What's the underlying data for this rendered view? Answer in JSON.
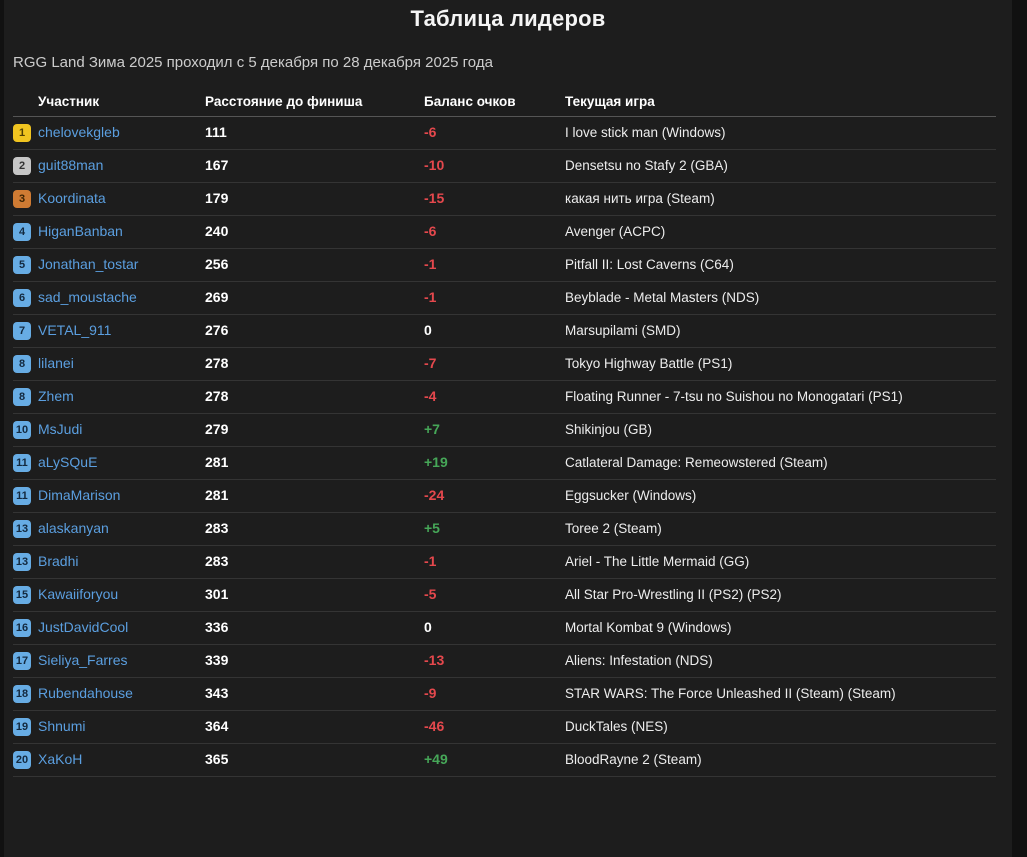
{
  "page": {
    "title": "Таблица лидеров",
    "subtitle": "RGG Land Зима 2025 проходил с 5 декабря по 28 декабря 2025 года"
  },
  "colors": {
    "accent_link": "#5b9fe0",
    "negative": "#e5484d",
    "positive": "#46a758",
    "badge_gold": "#f0c420",
    "badge_silver": "#c6c6c6",
    "badge_bronze": "#cf7b33",
    "badge_blue": "#67ace4"
  },
  "table": {
    "columns": [
      "Участник",
      "Расстояние до финиша",
      "Баланс очков",
      "Текущая игра"
    ],
    "rows": [
      {
        "rank": "1",
        "name": "chelovekgleb",
        "distance": "111",
        "balance": "-6",
        "game": "I love stick man (Windows)"
      },
      {
        "rank": "2",
        "name": "guit88man",
        "distance": "167",
        "balance": "-10",
        "game": "Densetsu no Stafy 2 (GBA)"
      },
      {
        "rank": "3",
        "name": "Koordinata",
        "distance": "179",
        "balance": "-15",
        "game": "какая нить игра (Steam)"
      },
      {
        "rank": "4",
        "name": "HiganBanban",
        "distance": "240",
        "balance": "-6",
        "game": "Avenger (ACPC)"
      },
      {
        "rank": "5",
        "name": "Jonathan_tostar",
        "distance": "256",
        "balance": "-1",
        "game": "Pitfall II: Lost Caverns (C64)"
      },
      {
        "rank": "6",
        "name": "sad_moustache",
        "distance": "269",
        "balance": "-1",
        "game": "Beyblade - Metal Masters (NDS)"
      },
      {
        "rank": "7",
        "name": "VETAL_911",
        "distance": "276",
        "balance": "0",
        "game": "Marsupilami (SMD)"
      },
      {
        "rank": "8",
        "name": "lilanei",
        "distance": "278",
        "balance": "-7",
        "game": "Tokyo Highway Battle (PS1)"
      },
      {
        "rank": "8",
        "name": "Zhem",
        "distance": "278",
        "balance": "-4",
        "game": "Floating Runner - 7-tsu no Suishou no Monogatari (PS1)"
      },
      {
        "rank": "10",
        "name": "MsJudi",
        "distance": "279",
        "balance": "+7",
        "game": "Shikinjou (GB)"
      },
      {
        "rank": "11",
        "name": "aLySQuE",
        "distance": "281",
        "balance": "+19",
        "game": "Catlateral Damage: Remeowstered (Steam)"
      },
      {
        "rank": "11",
        "name": "DimaMarison",
        "distance": "281",
        "balance": "-24",
        "game": "Eggsucker (Windows)"
      },
      {
        "rank": "13",
        "name": "alaskanyan",
        "distance": "283",
        "balance": "+5",
        "game": "Toree 2 (Steam)"
      },
      {
        "rank": "13",
        "name": "Bradhi",
        "distance": "283",
        "balance": "-1",
        "game": "Ariel - The Little Mermaid (GG)"
      },
      {
        "rank": "15",
        "name": "Kawaiiforyou",
        "distance": "301",
        "balance": "-5",
        "game": "All Star Pro-Wrestling II (PS2) (PS2)"
      },
      {
        "rank": "16",
        "name": "JustDavidCool",
        "distance": "336",
        "balance": "0",
        "game": "Mortal Kombat 9 (Windows)"
      },
      {
        "rank": "17",
        "name": "Sieliya_Farres",
        "distance": "339",
        "balance": "-13",
        "game": "Aliens: Infestation (NDS)"
      },
      {
        "rank": "18",
        "name": "Rubendahouse",
        "distance": "343",
        "balance": "-9",
        "game": "STAR WARS: The Force Unleashed II (Steam) (Steam)"
      },
      {
        "rank": "19",
        "name": "Shnumi",
        "distance": "364",
        "balance": "-46",
        "game": "DuckTales (NES)"
      },
      {
        "rank": "20",
        "name": "XaKoH",
        "distance": "365",
        "balance": "+49",
        "game": "BloodRayne 2 (Steam)"
      }
    ]
  }
}
